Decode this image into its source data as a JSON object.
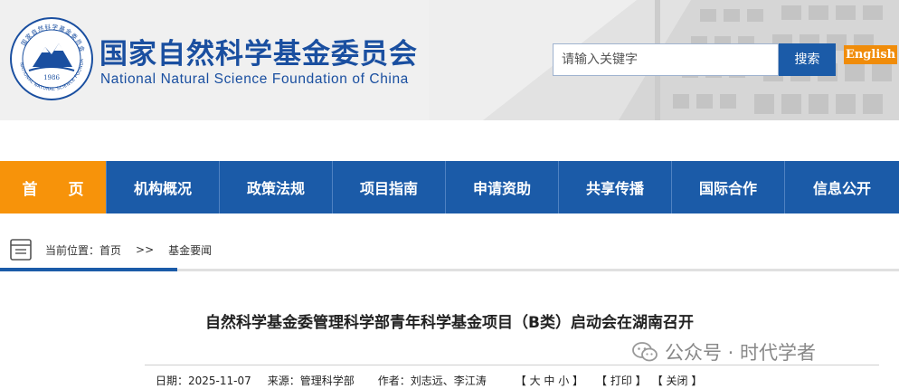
{
  "header": {
    "cn_title": "国家自然科学基金委员会",
    "en_title": "National Natural Science Foundation of China",
    "logo_year": "1986",
    "search_placeholder": "请输入关键字",
    "search_button": "搜索",
    "english_button": "English"
  },
  "nav": {
    "items": [
      {
        "label": "首 页"
      },
      {
        "label": "机构概况"
      },
      {
        "label": "政策法规"
      },
      {
        "label": "项目指南"
      },
      {
        "label": "申请资助"
      },
      {
        "label": "共享传播"
      },
      {
        "label": "国际合作"
      },
      {
        "label": "信息公开"
      }
    ]
  },
  "breadcrumb": {
    "prefix": "当前位置：首页",
    "separator": ">>",
    "current": "基金要闻"
  },
  "article": {
    "title": "自然科学基金委管理科学部青年科学基金项目（B类）启动会在湖南召开",
    "date": "日期：2025-11-07",
    "source": "来源：管理科学部",
    "author": "作者：刘志远、李江涛",
    "font_size_tool": "【 大 中 小 】",
    "print_tool": "【 打印 】",
    "close_tool": "【 关闭 】"
  },
  "watermark": {
    "text": "公众号 · 时代学者"
  },
  "colors": {
    "brand_blue": "#1b5ba8",
    "home_orange": "#f7930a",
    "english_orange": "#f08c0a"
  }
}
